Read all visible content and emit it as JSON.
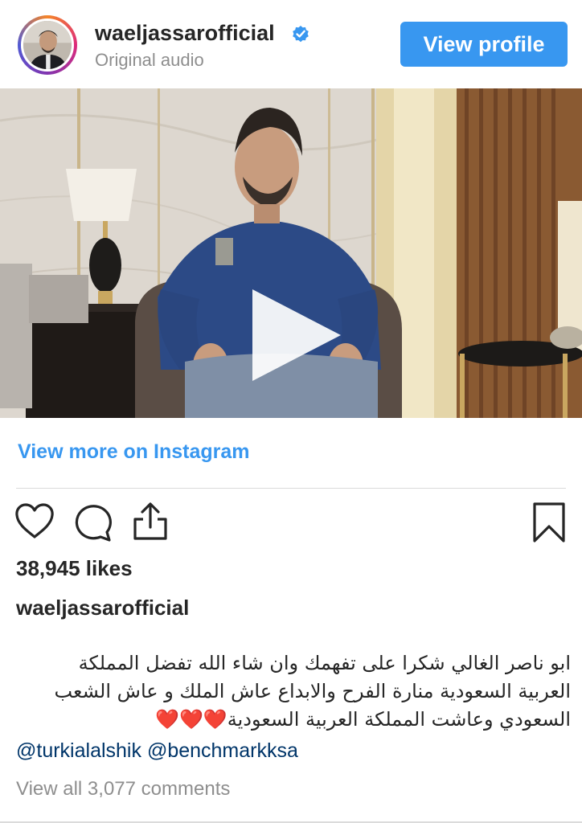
{
  "header": {
    "username": "waeljassarofficial",
    "subtitle": "Original audio",
    "view_profile_label": "View profile",
    "verified_icon": "verified-badge-icon"
  },
  "video": {
    "play_icon": "play-icon"
  },
  "links": {
    "view_more": "View more on Instagram"
  },
  "actions": {
    "like_icon": "heart-icon",
    "comment_icon": "comment-icon",
    "share_icon": "share-icon",
    "save_icon": "bookmark-icon"
  },
  "post": {
    "likes": "38,945 likes",
    "caption_user": "waeljassarofficial",
    "caption_lines": [
      "ابو ناصر الغالي شكرا على تفهمك وان شاء الله تفضل المملكة",
      "العربية السعودية منارة الفرح والابداع عاش الملك و عاش الشعب",
      "السعودي وعاشت المملكة العربية السعودية❤️❤️❤️"
    ],
    "mention_1": "@turkialalshik",
    "mention_2": "@benchmarkksa",
    "view_all_comments": "View all 3,077 comments"
  },
  "colors": {
    "accent": "#3897f0",
    "text": "#262626",
    "muted": "#8e8e8e",
    "mention": "#003569"
  }
}
